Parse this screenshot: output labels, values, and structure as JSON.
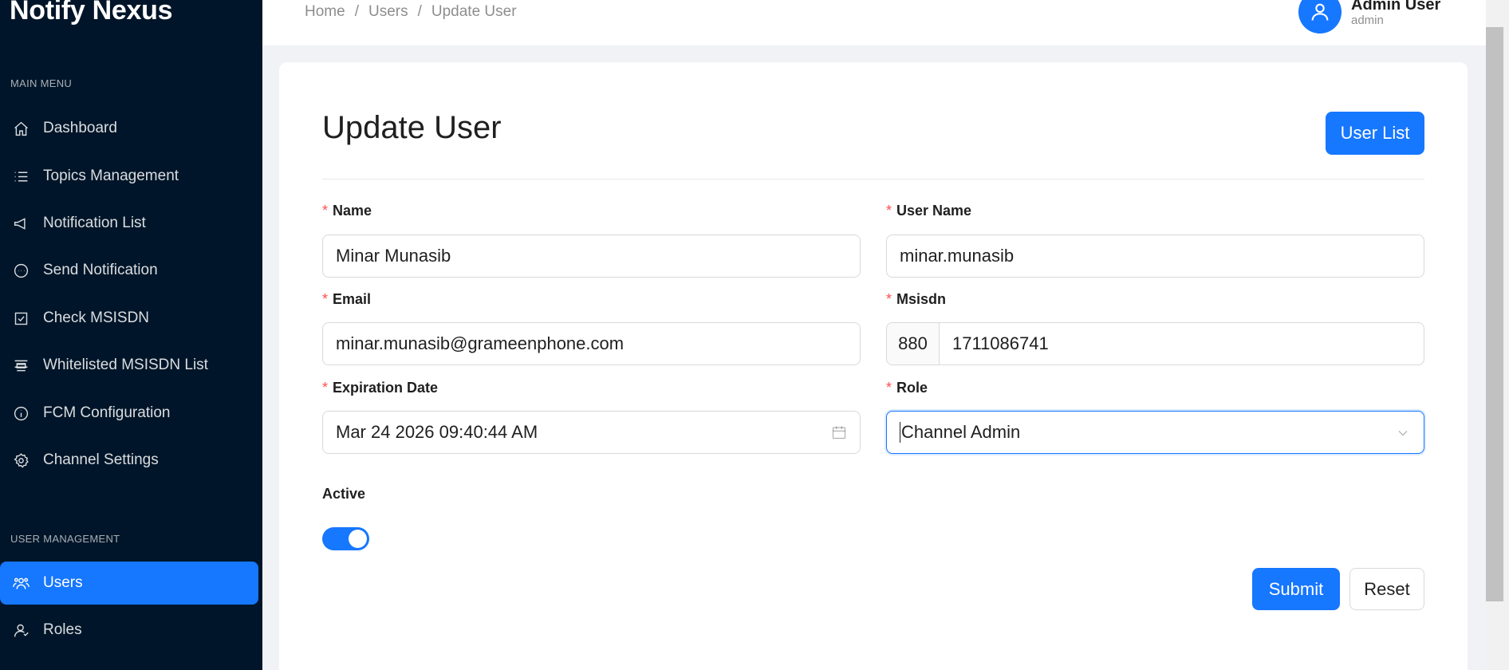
{
  "app": {
    "name": "Notify Nexus"
  },
  "sidebar": {
    "groups": {
      "main": "MAIN MENU",
      "user_management": "USER MANAGEMENT"
    },
    "items": [
      {
        "label": "Dashboard",
        "icon": "home-icon"
      },
      {
        "label": "Topics Management",
        "icon": "list-icon"
      },
      {
        "label": "Notification List",
        "icon": "megaphone-icon"
      },
      {
        "label": "Send Notification",
        "icon": "message-icon"
      },
      {
        "label": "Check MSISDN",
        "icon": "checkbox-icon"
      },
      {
        "label": "Whitelisted MSISDN List",
        "icon": "align-icon"
      },
      {
        "label": "FCM Configuration",
        "icon": "info-icon"
      },
      {
        "label": "Channel Settings",
        "icon": "gear-icon"
      },
      {
        "label": "Users",
        "icon": "users-icon",
        "active": true
      },
      {
        "label": "Roles",
        "icon": "user-icon"
      }
    ]
  },
  "header": {
    "breadcrumb": [
      "Home",
      "Users",
      "Update User"
    ],
    "separator": "/",
    "user": {
      "name": "Admin User",
      "role": "admin"
    }
  },
  "main": {
    "title": "Update User",
    "user_list_button": "User List",
    "required_mark": "*",
    "form": {
      "name": {
        "label": "Name",
        "value": "Minar Munasib"
      },
      "username": {
        "label": "User Name",
        "value": "minar.munasib"
      },
      "email": {
        "label": "Email",
        "value": "minar.munasib@grameenphone.com"
      },
      "msisdn": {
        "label": "Msisdn",
        "prefix": "880",
        "value": "1711086741"
      },
      "expiration": {
        "label": "Expiration Date",
        "value": "Mar 24 2026 09:40:44 AM"
      },
      "role": {
        "label": "Role",
        "value": "Channel Admin"
      },
      "active": {
        "label": "Active",
        "checked": true
      }
    },
    "submit_label": "Submit",
    "reset_label": "Reset"
  },
  "colors": {
    "sidebar_bg": "#001529",
    "primary": "#1677ff",
    "required": "#ff4d4f"
  }
}
